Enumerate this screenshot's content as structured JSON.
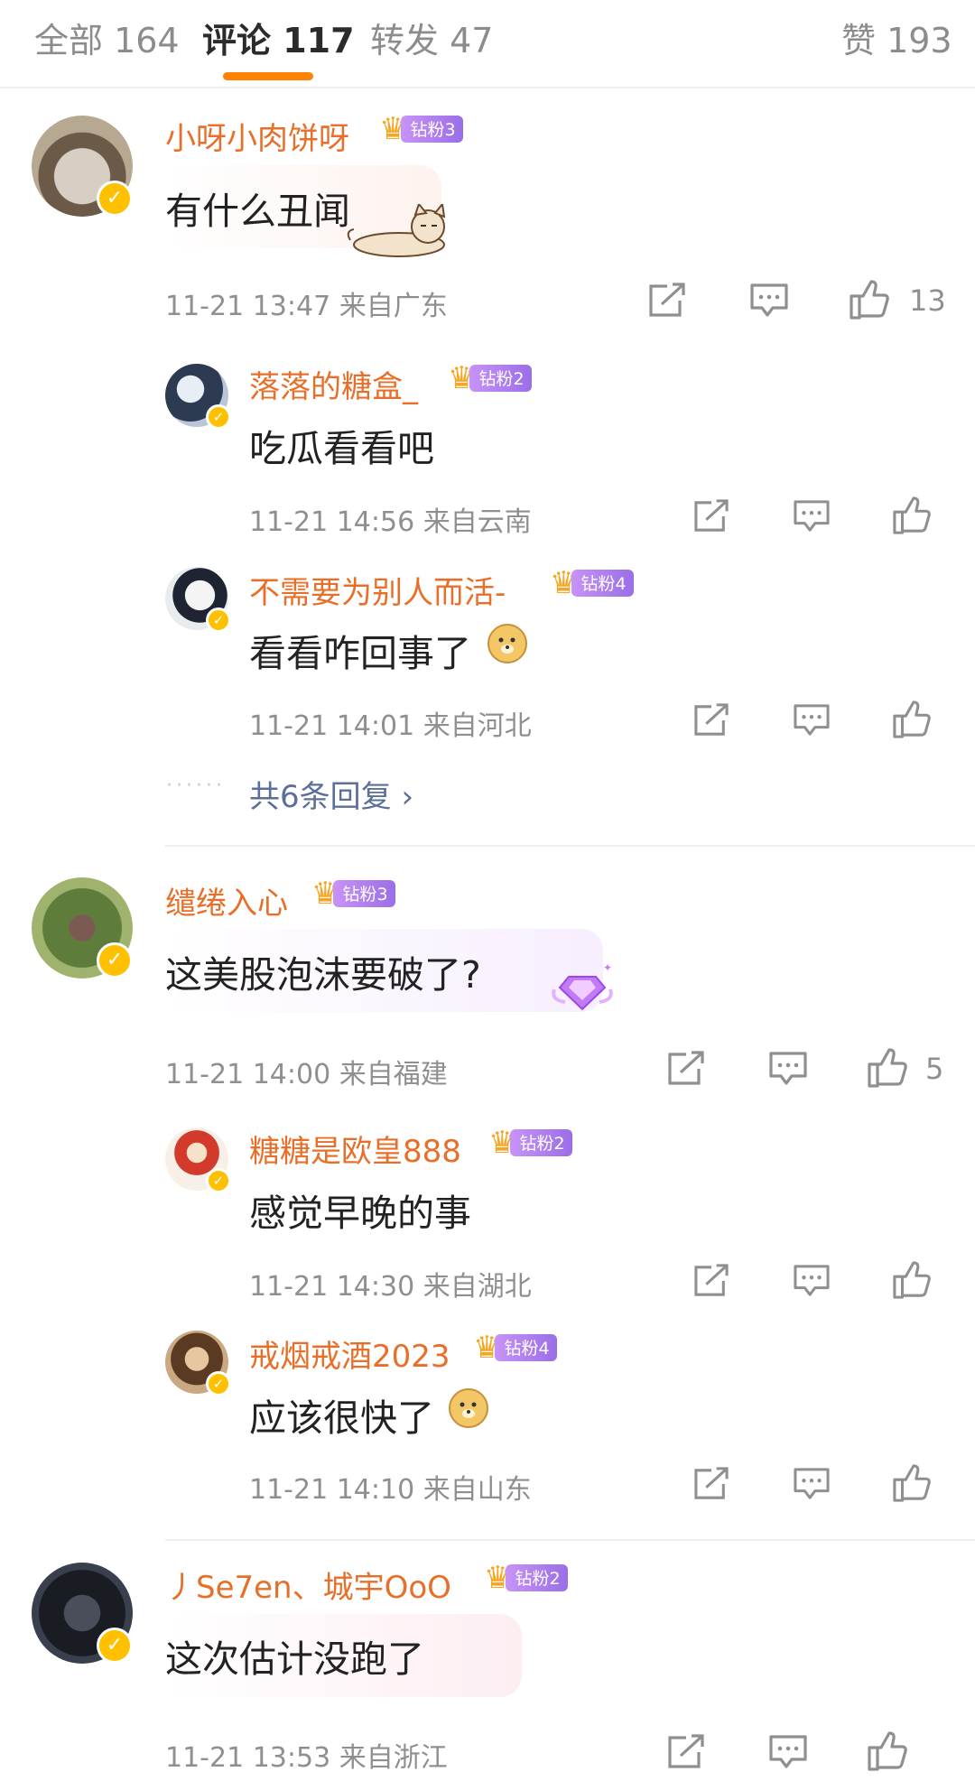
{
  "tabs": {
    "all": "全部 164",
    "comments": "评论 117",
    "reposts": "转发 47",
    "likes": "赞 193"
  },
  "colors": {
    "accent": "#ff8200",
    "username": "#e86f29",
    "fan_badge": "#a97cf0",
    "meta": "#8f8f8f",
    "more_link": "#5b6f9a"
  },
  "comments": [
    {
      "user": "小呀小肉饼呀",
      "fan_level": "钻粉3",
      "text": "有什么丑闻",
      "sticker": "dog-sticker",
      "time": "11-21 13:47",
      "location": "来自广东",
      "likes": "13",
      "replies": [
        {
          "user": "落落的糖盒_",
          "fan_level": "钻粉2",
          "text": "吃瓜看看吧",
          "time": "11-21 14:56",
          "location": "来自云南"
        },
        {
          "user": "不需要为别人而活-",
          "fan_level": "钻粉4",
          "text": "看看咋回事了",
          "emoji": "doge-emoji",
          "time": "11-21 14:01",
          "location": "来自河北"
        }
      ],
      "more_replies": "共6条回复 ›"
    },
    {
      "user": "缱绻入心",
      "fan_level": "钻粉3",
      "text": "这美股泡沫要破了?",
      "sticker": "diamond-sticker",
      "time": "11-21 14:00",
      "location": "来自福建",
      "likes": "5",
      "replies": [
        {
          "user": "糖糖是欧皇888",
          "fan_level": "钻粉2",
          "text": "感觉早晚的事",
          "time": "11-21 14:30",
          "location": "来自湖北"
        },
        {
          "user": "戒烟戒酒2023",
          "fan_level": "钻粉4",
          "text": "应该很快了",
          "emoji": "doge-emoji",
          "time": "11-21 14:10",
          "location": "来自山东"
        }
      ]
    },
    {
      "user": "丿Se7en、城宇OoO",
      "fan_level": "钻粉2",
      "text": "这次估计没跑了",
      "time": "11-21 13:53",
      "location": "来自浙江",
      "likes": ""
    }
  ]
}
